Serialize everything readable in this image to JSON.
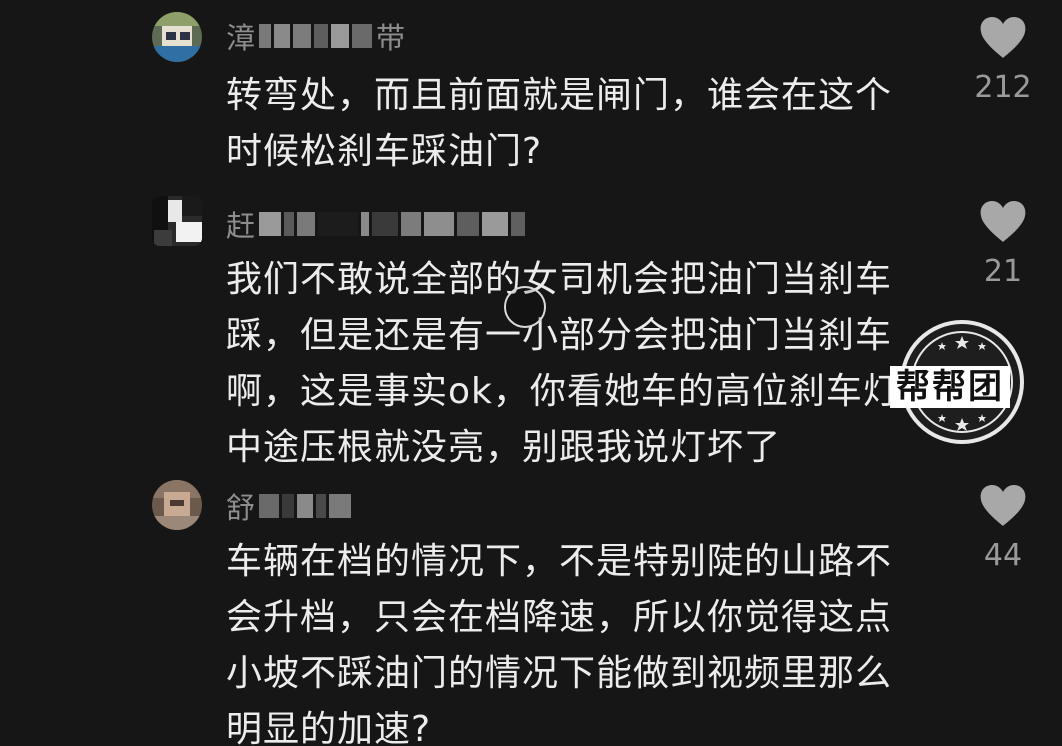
{
  "comments": [
    {
      "username_start": "漳",
      "username_end": "带",
      "text_lines": [
        "转弯处，而且前面就是闸门，谁会在这个",
        "时候松刹车踩油门?"
      ],
      "likes": "212",
      "avatar_icon": "avatar-photo"
    },
    {
      "username_start": "赶",
      "username_end": "",
      "text_lines": [
        "我们不敢说全部的女司机会把油门当刹车",
        "踩，但是还是有一小部分会把油门当刹车",
        "啊，这是事实ok，你看她车的高位刹车灯",
        "中途压根就没亮，别跟我说灯坏了"
      ],
      "likes": "21",
      "avatar_icon": "avatar-photo"
    },
    {
      "username_start": "舒",
      "username_end": "",
      "text_lines": [
        "车辆在档的情况下，不是特别陡的山路不",
        "会升档，只会在档降速，所以你觉得这点",
        "小坡不踩油门的情况下能做到视频里那么",
        "明显的加速?"
      ],
      "likes": "44",
      "avatar_icon": "avatar-photo"
    }
  ],
  "watermark": {
    "text": "帮帮团"
  },
  "colors": {
    "background": "#161616",
    "text": "#ececec",
    "username": "#8d8d8d",
    "heart": "#a8a8a8"
  },
  "icons": {
    "like": "heart-icon",
    "pointer": "touch-cursor-icon"
  }
}
